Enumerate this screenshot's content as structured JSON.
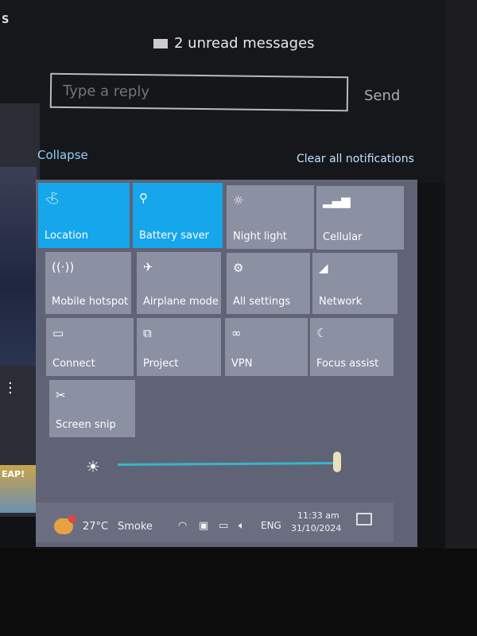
{
  "background_fragment": {
    "corner_text": "S",
    "thumbnail_text": "EAP!",
    "more_icon": "vertical-dots-icon"
  },
  "notification": {
    "icon": "mail-icon",
    "title": "2 unread messages",
    "reply_placeholder": "Type a reply",
    "send_label": "Send"
  },
  "action_center": {
    "collapse_label": "Collapse",
    "clear_all_label": "Clear all notifications",
    "accent_color": "#16a6ec",
    "tiles": [
      {
        "label": "Location",
        "icon": "location-icon",
        "active": true
      },
      {
        "label": "Battery saver",
        "icon": "battery-saver-icon",
        "active": true
      },
      {
        "label": "Night light",
        "icon": "night-light-icon",
        "active": false
      },
      {
        "label": "Cellular",
        "icon": "cellular-icon",
        "active": false
      },
      {
        "label": "Mobile hotspot",
        "icon": "hotspot-icon",
        "active": false
      },
      {
        "label": "Airplane mode",
        "icon": "airplane-icon",
        "active": false
      },
      {
        "label": "All settings",
        "icon": "gear-icon",
        "active": false
      },
      {
        "label": "Network",
        "icon": "network-icon",
        "active": false
      },
      {
        "label": "Connect",
        "icon": "connect-icon",
        "active": false
      },
      {
        "label": "Project",
        "icon": "project-icon",
        "active": false
      },
      {
        "label": "VPN",
        "icon": "vpn-icon",
        "active": false
      },
      {
        "label": "Focus assist",
        "icon": "moon-icon",
        "active": false
      },
      {
        "label": "Screen snip",
        "icon": "screen-snip-icon",
        "active": false
      }
    ],
    "brightness_percent": 100
  },
  "taskbar": {
    "weather_temp": "27°C",
    "weather_condition": "Smoke",
    "tray_icons": [
      "wifi-icon",
      "meet-now-icon",
      "battery-icon",
      "volume-icon"
    ],
    "language": "ENG",
    "time": "11:33 am",
    "date": "31/10/2024"
  }
}
